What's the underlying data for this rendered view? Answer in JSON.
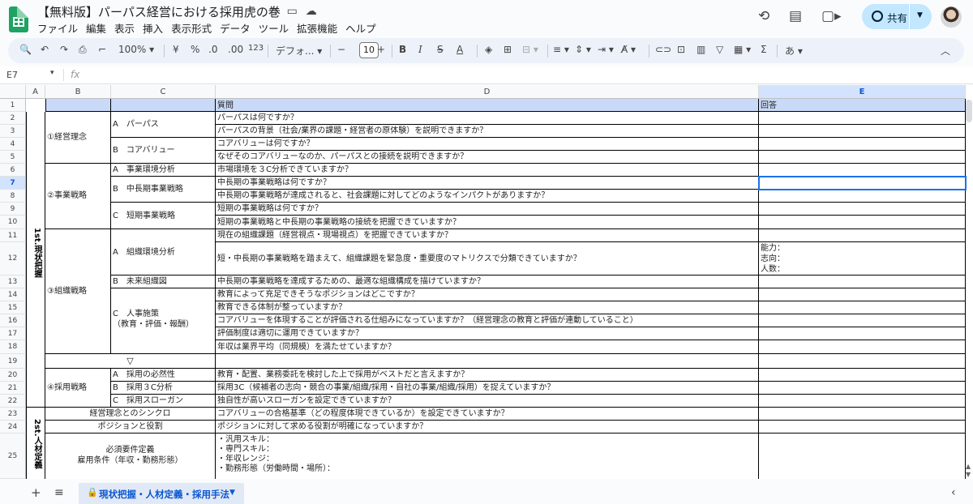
{
  "app": {
    "title": "【無料版】パーパス経営における採用虎の巻",
    "menu": [
      "ファイル",
      "編集",
      "表示",
      "挿入",
      "表示形式",
      "データ",
      "ツール",
      "拡張機能",
      "ヘルプ"
    ],
    "share_label": "共有",
    "accent": "#c2e7ff"
  },
  "toolbar": {
    "zoom": "100%",
    "currency": "¥",
    "percent": "%",
    "dec_less": ".0",
    "dec_more": ".00",
    "format": "123",
    "font": "デフォ...",
    "font_size": "10",
    "input_tool": "あ"
  },
  "formula": {
    "cell_ref": "E7",
    "fx": "fx",
    "value": ""
  },
  "columns": [
    "A",
    "B",
    "C",
    "D",
    "E"
  ],
  "rows": [
    "1",
    "2",
    "3",
    "4",
    "5",
    "6",
    "7",
    "8",
    "9",
    "10",
    "11",
    "12",
    "13",
    "14",
    "15",
    "16",
    "17",
    "18",
    "19",
    "20",
    "21",
    "22",
    "23",
    "24",
    "25"
  ],
  "sheet": {
    "header_question": "質問",
    "header_answer": "回答",
    "sec1": "1st.現状把握",
    "sec2": "2st.人材定義",
    "b_keiei": "①経営理念",
    "b_jigyo": "②事業戦略",
    "b_soshiki": "③組織戦略",
    "b_saiyo": "④採用戦略",
    "c2": "A　パーパス",
    "c4": "B　コアバリュー",
    "c6": "A　事業環境分析",
    "c7": "B　中長期事業戦略",
    "c9": "C　短期事業戦略",
    "c11": "A　組織環境分析",
    "c13": "B　未来組織図",
    "c14a": "C　人事施策",
    "c14b": "（教育・評価・報酬）",
    "c19": "▽",
    "c20": "A　採用の必然性",
    "c21": "B　採用３C分析",
    "c22": "C　採用スローガン",
    "bc23": "経営理念とのシンクロ",
    "bc24": "ポジションと役割",
    "bc25a": "必須要件定義",
    "bc25b": "雇用条件（年収・勤務形態）",
    "d": [
      "パーパスは何ですか？",
      "パーパスの背景（社会/業界の課題・経営者の原体験）を説明できますか？",
      "コアバリューは何ですか？",
      "なぜそのコアバリューなのか、パーパスとの接続を説明できますか？",
      "市場環境を３C分析できていますか？",
      "中長期の事業戦略は何ですか？",
      "中長期の事業戦略が達成されると、社会課題に対してどのようなインパクトがありますか？",
      "短期の事業戦略は何ですか？",
      "短期の事業戦略と中長期の事業戦略の接続を把握できていますか？",
      "現在の組織課題（経営視点・現場視点）を把握できていますか？",
      "短・中長期の事業戦略を踏まえて、組織課題を緊急度・重要度のマトリクスで分類できていますか？",
      "中長期の事業戦略を達成するための、最適な組織構成を描けていますか？",
      "教育によって充足できそうなポジションはどこですか？",
      "教育できる体制が整っていますか？",
      "コアバリューを体現することが評価される仕組みになっていますか？（経営理念の教育と評価が連動していること）",
      "評価制度は適切に運用できていますか？",
      "年収は業界平均（同規模）を満たせていますか？",
      "",
      "教育・配置、業務委託を検討した上で採用がベストだと言えますか？",
      "採用3C（候補者の志向・競合の事業/組織/採用・自社の事業/組織/採用）を捉えていますか？",
      "独自性が高いスローガンを設定できていますか？",
      "コアバリューの合格基準（どの程度体現できているか）を設定できていますか？",
      "ポジションに対して求める役割が明確になっていますか？"
    ],
    "d25": [
      "・汎用スキル：",
      "・専門スキル：",
      "・年収レンジ：",
      "・勤務形態（労働時間・場所）："
    ],
    "e12": [
      "能力：",
      "志向：",
      "人数："
    ]
  },
  "sheet_tab": "現状把握・人材定義・採用手法"
}
